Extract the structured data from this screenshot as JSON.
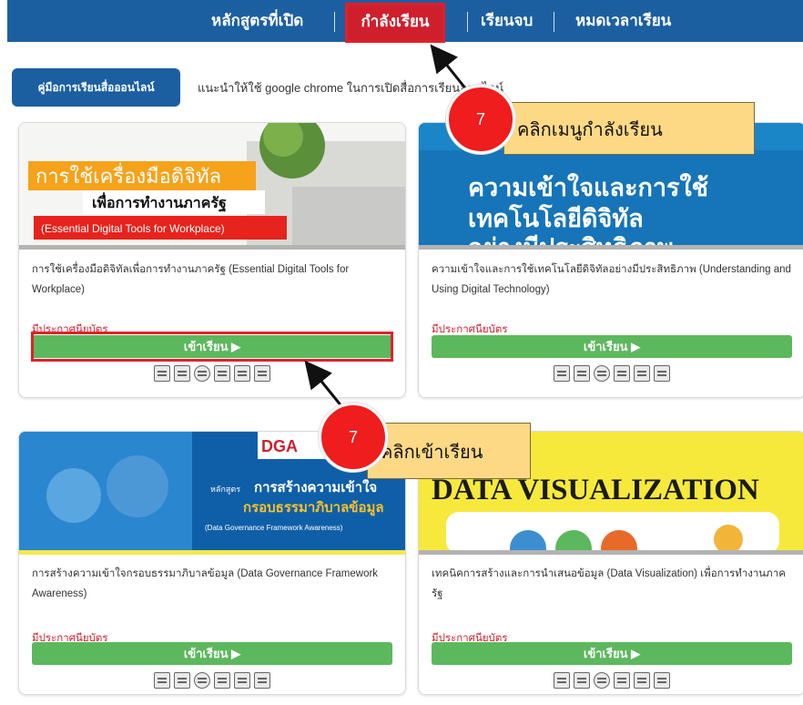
{
  "nav": {
    "items": [
      "หลักสูตรที่เปิด",
      "กำลังเรียน",
      "เรียนจบ",
      "หมดเวลาเรียน"
    ],
    "active_index": 1
  },
  "guide_button": "คู่มือการเรียนสื่อออนไลน์",
  "guide_note": "แนะนำให้ใช้ google chrome ในการเปิดสื่อการเรียนออนไลน์",
  "courses": [
    {
      "thumb_title": "การใช้เครื่องมือดิจิทัล",
      "thumb_sub": "เพื่อการทำงานภาครัฐ",
      "thumb_en": "(Essential Digital Tools for Workplace)",
      "title": "การใช้เครื่องมือดิจิทัลเพื่อการทำงานภาครัฐ (Essential Digital Tools for Workplace)",
      "cert": "มีประกาศนียบัตร",
      "button": "เข้าเรียน ▶"
    },
    {
      "thumb_title": "ความเข้าใจและการใช้",
      "thumb_sub": "เทคโนโลยีดิจิทัล",
      "thumb_en": "อย่างมีประสิทธิภาพ",
      "title": "ความเข้าใจและการใช้เทคโนโลยีดิจิทัลอย่างมีประสิทธิภาพ (Understanding and Using Digital Technology)",
      "cert": "มีประกาศนียบัตร",
      "button": "เข้าเรียน ▶"
    },
    {
      "thumb_title": "การสร้างความเข้าใจ",
      "thumb_sub": "กรอบธรรมาภิบาลข้อมูล",
      "thumb_en": "(Data Governance Framework Awareness)",
      "thumb_logo": "DGA",
      "thumb_prefix": "หลักสูตร",
      "title": "การสร้างความเข้าใจกรอบธรรมาภิบาลข้อมูล (Data Governance Framework Awareness)",
      "cert": "มีประกาศนียบัตร",
      "button": "เข้าเรียน ▶"
    },
    {
      "thumb_title": "DATA VISUALIZATION",
      "title": "เทคนิคการสร้างและการนำเสนอข้อมูล (Data Visualization) เพื่อการทำงานภาครัฐ",
      "cert": "มีประกาศนียบัตร",
      "button": "เข้าเรียน ▶"
    }
  ],
  "callouts": [
    {
      "number": "7",
      "text": "คลิกเมนูกำลังเรียน"
    },
    {
      "number": "7",
      "text": "คลิกเข้าเรียน"
    }
  ],
  "colors": {
    "nav_bg": "#1c5fa1",
    "active_tab": "#cf1f2d",
    "enter_button": "#5cb85c",
    "cert_text": "#d0202e",
    "callout_circle": "#ef1d1d",
    "callout_box": "#fdd986"
  },
  "icons": [
    "edit-icon",
    "calendar-icon",
    "globe-icon",
    "document-icon",
    "notes-icon",
    "comment-icon"
  ]
}
